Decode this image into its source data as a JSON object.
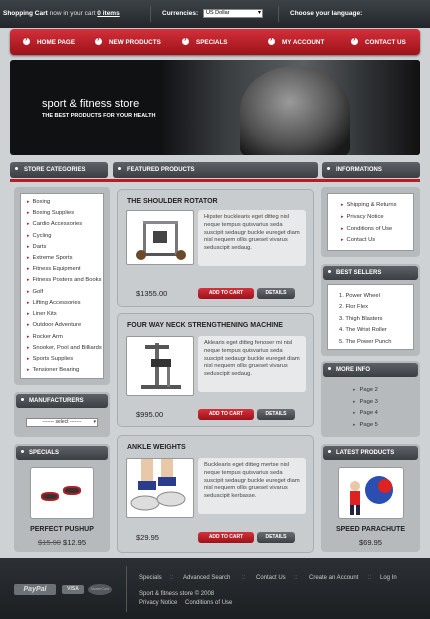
{
  "topbar": {
    "cart_label": "Shopping Cart",
    "cart_sub": "now in your cart",
    "cart_items": "0 items",
    "currencies_label": "Currencies:",
    "currency_value": "US Dollar",
    "language_label": "Choose your language:"
  },
  "nav": [
    "HOME PAGE",
    "NEW PRODUCTS",
    "SPECIALS",
    "MY ACCOUNT",
    "CONTACT US"
  ],
  "banner": {
    "title": "sport & fitness store",
    "tagline": "THE BEST PRODUCTS FOR YOUR HEALTH"
  },
  "sections": {
    "categories": "STORE CATEGORIES",
    "featured": "FEATURED PRODUCTS",
    "information": "INFORMATIONS"
  },
  "categories": [
    "Boxing",
    "Boxing Supplies",
    "Cardio Accessories",
    "Cycling",
    "Darts",
    "Extreme Sports",
    "Fitness Equipment",
    "Fitness Posters and Books",
    "Golf",
    "Lifting Accessories",
    "Liner Kits",
    "Outdoor Adventure",
    "Rocker Arm",
    "Snooker, Pool and Billiards",
    "Sports Supplies",
    "Tensioner Bearing"
  ],
  "manufacturers": {
    "title": "MANUFACTURERS",
    "select": "------- select -------"
  },
  "specials": {
    "title": "SPECIALS",
    "name": "PERFECT PUSHUP",
    "old_price": "$15.00",
    "new_price": "$12.95"
  },
  "products": [
    {
      "title": "THE SHOULDER ROTATOR",
      "desc": "Hipster bucklearis eget ditteg nisl neque tempus quisvarius seda suscipit sedaugr buckle eureget diam nisl nequem ollis grueset vivarus seduscipit sedaug.",
      "price": "$1355.00",
      "add": "ADD TO CART",
      "details": "DETAILS"
    },
    {
      "title": "FOUR WAY NECK STRENGTHENING MACHINE",
      "desc": "Aklearis eget ditteg fenoser mi nisl neque tempus quisvarius seda suscipit sedaugr buckle eureget diam nisl nequem ollis grueset vivarus seduscipit sedaug.",
      "price": "$995.00",
      "add": "ADD TO CART",
      "details": "DETAILS"
    },
    {
      "title": "ANKLE WEIGHTS",
      "desc": "Bucklearis eget ditteg mertse nisl neque tempus quisvarius seda suscipit sedaugr buckle eureget diam nisl nequem ollis grueset vivarus seduscipit kerbasse.",
      "price": "$29.95",
      "add": "ADD TO CART",
      "details": "DETAILS"
    }
  ],
  "information": [
    "Shipping & Returns",
    "Privacy Notice",
    "Conditions of Use",
    "Contact Us"
  ],
  "bestsellers": {
    "title": "BEST SELLERS",
    "items": [
      "1. Power Wheel",
      "2. Flor Flex",
      "3. Thigh Blasters",
      "4. The Wrist Roller",
      "5. The Power Punch"
    ]
  },
  "moreinfo": {
    "title": "MORE INFO",
    "items": [
      "Page 2",
      "Page 3",
      "Page 4",
      "Page 5"
    ]
  },
  "latest": {
    "title": "LATEST PRODUCTS",
    "name": "SPEED PARACHUTE",
    "price": "$69.95"
  },
  "footer": {
    "links": [
      "Specials",
      "Advanced Search",
      "Contact Us",
      "Create an Account",
      "Log In"
    ],
    "separator": "::",
    "copyright": "Sport & fitness store © 2008",
    "privacy": "Privacy Notice",
    "conditions": "Conditions of Use",
    "paypal": "PayPal",
    "visa": "VISA",
    "mastercard": "MasterCard"
  },
  "colors": {
    "accent": "#b51e24",
    "dark": "#2c3034",
    "panel": "#b6babd"
  }
}
